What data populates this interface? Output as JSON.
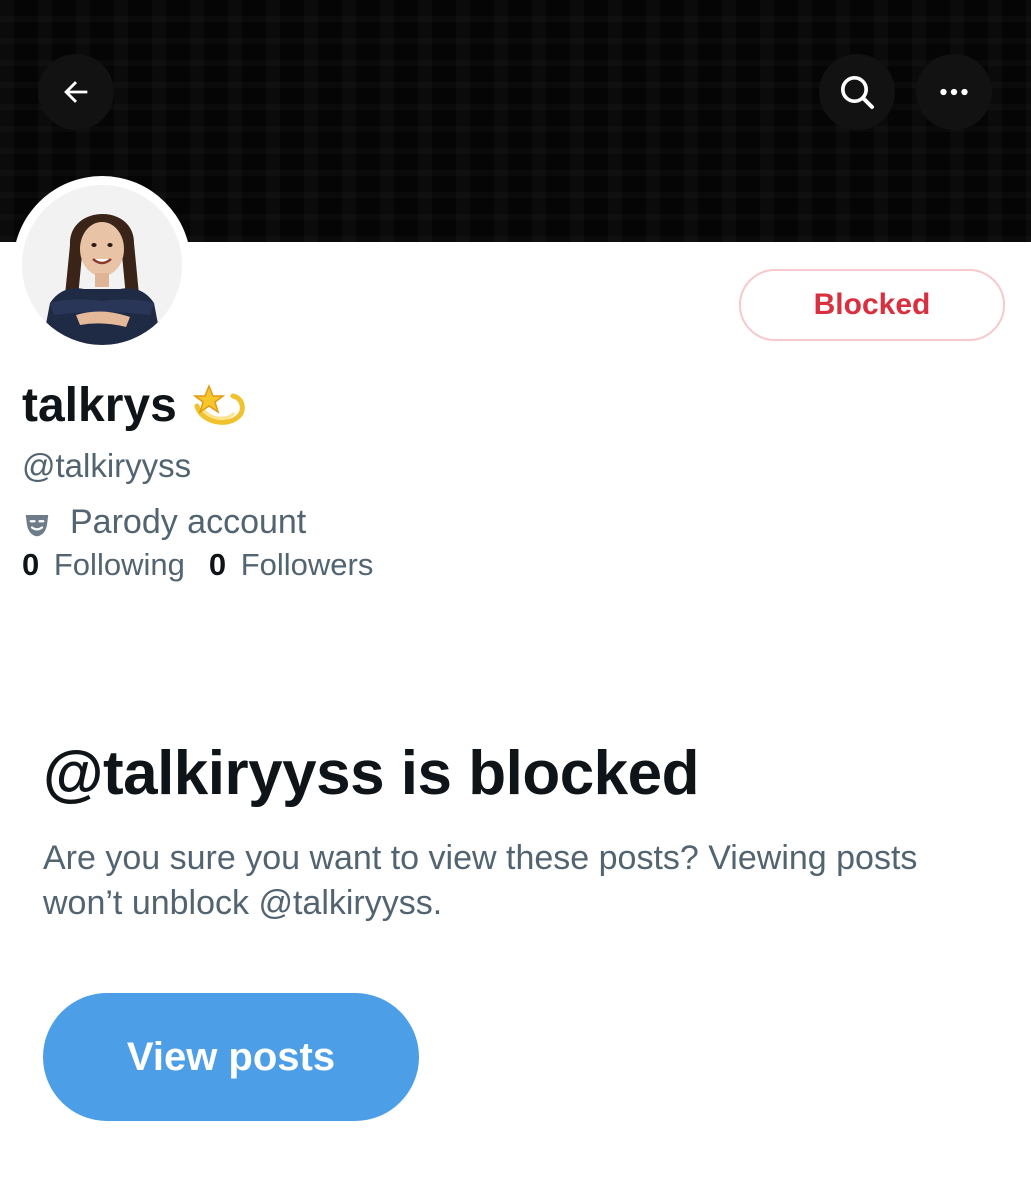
{
  "header": {
    "back_icon": "arrow-left-icon",
    "search_icon": "search-icon",
    "more_icon": "more-horizontal-icon"
  },
  "profile": {
    "avatar_icon": "avatar",
    "blocked_button_label": "Blocked",
    "blocked_color": "#d9303f",
    "display_name": "talkrys",
    "name_emoji": "dizzy-icon",
    "handle": "@talkiryyss",
    "label_icon": "theater-mask-icon",
    "label_text": "Parody account",
    "following_count": "0",
    "following_label": "Following",
    "followers_count": "0",
    "followers_label": "Followers"
  },
  "blocked_notice": {
    "title": "@talkiryyss is blocked",
    "description": "Are you sure you want to view these posts? Viewing posts won’t unblock @talkiryyss.",
    "view_posts_label": "View posts",
    "accent": "#4c9ee7"
  }
}
